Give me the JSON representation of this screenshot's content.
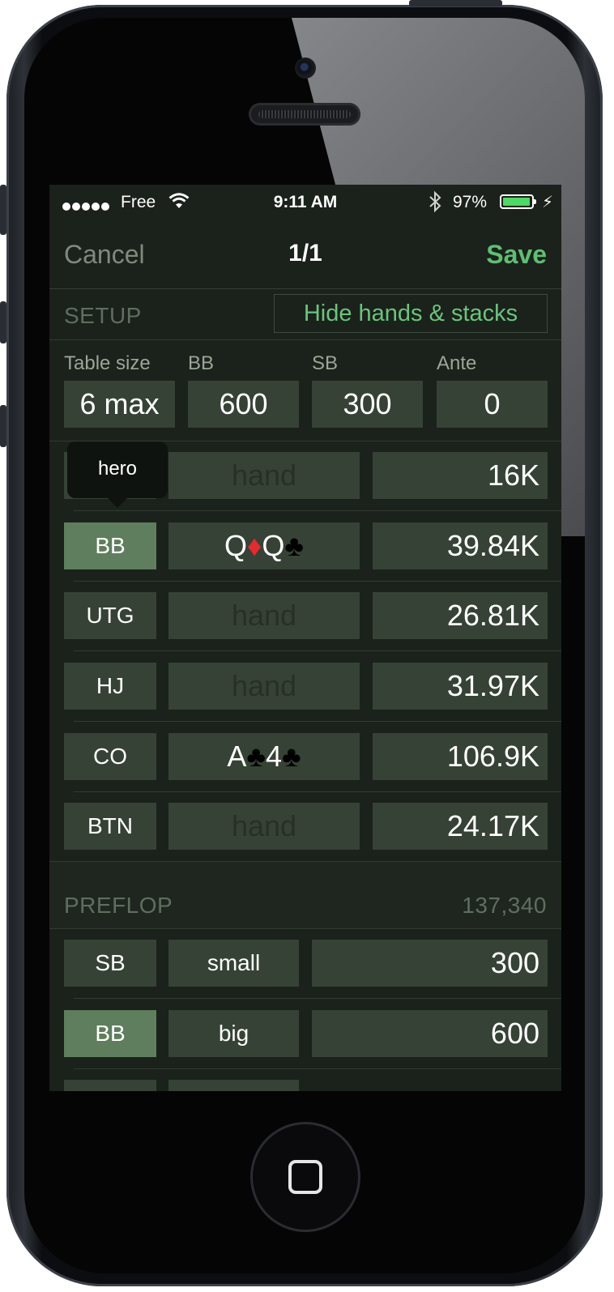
{
  "status_bar": {
    "carrier": "Free",
    "time": "9:11 AM",
    "battery_percent": "97%",
    "battery_level": 0.97
  },
  "nav": {
    "cancel": "Cancel",
    "title": "1/1",
    "save": "Save"
  },
  "setup": {
    "label": "SETUP",
    "hide_button": "Hide hands & stacks",
    "fields": [
      {
        "label": "Table size",
        "value": "6 max"
      },
      {
        "label": "BB",
        "value": "600"
      },
      {
        "label": "SB",
        "value": "300"
      },
      {
        "label": "Ante",
        "value": "0"
      }
    ]
  },
  "tooltip": "hero",
  "seats": [
    {
      "position": "",
      "hand": "hand",
      "stack": "16K"
    },
    {
      "position": "BB",
      "hand_cards": [
        {
          "rank": "Q",
          "suit": "♦"
        },
        {
          "rank": "Q",
          "suit": "♣"
        }
      ],
      "stack": "39.84K",
      "highlighted": true
    },
    {
      "position": "UTG",
      "hand": "hand",
      "stack": "26.81K"
    },
    {
      "position": "HJ",
      "hand": "hand",
      "stack": "31.97K"
    },
    {
      "position": "CO",
      "hand_cards": [
        {
          "rank": "A",
          "suit": "♣"
        },
        {
          "rank": "4",
          "suit": "♣"
        }
      ],
      "stack": "106.9K"
    },
    {
      "position": "BTN",
      "hand": "hand",
      "stack": "24.17K"
    }
  ],
  "preflop": {
    "label": "PREFLOP",
    "pot": "137,340",
    "actions": [
      {
        "position": "SB",
        "action": "small",
        "amount": "300"
      },
      {
        "position": "BB",
        "action": "big",
        "amount": "600",
        "highlighted": true
      }
    ]
  },
  "colors": {
    "accent_green": "#5dbf73",
    "highlight_position": "#5f7e5d",
    "field_bg": "#364235",
    "screen_bg": "#1b211b"
  }
}
